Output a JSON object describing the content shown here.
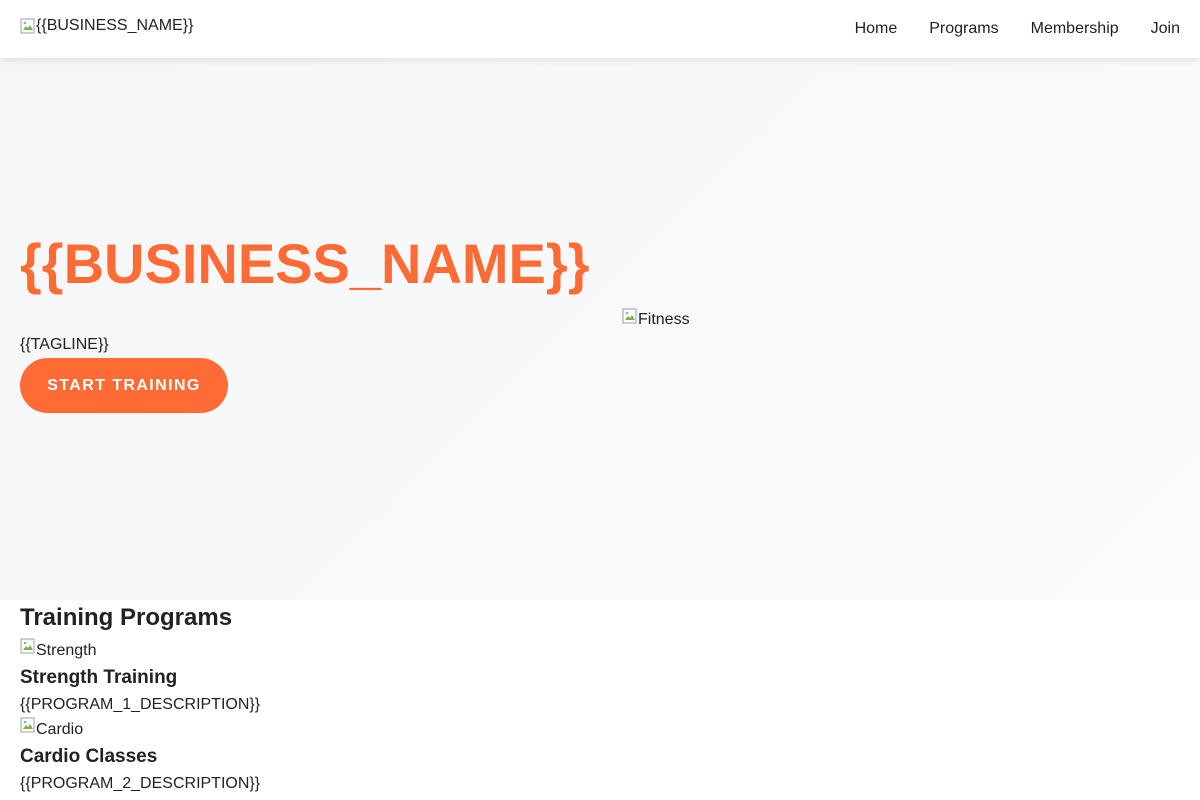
{
  "header": {
    "logo_alt": "{{BUSINESS_NAME}}",
    "nav": [
      {
        "label": "Home"
      },
      {
        "label": "Programs"
      },
      {
        "label": "Membership"
      },
      {
        "label": "Join"
      }
    ]
  },
  "hero": {
    "title": "{{BUSINESS_NAME}}",
    "tagline": "{{TAGLINE}}",
    "cta_label": "START TRAINING",
    "image_alt": "Fitness"
  },
  "programs": {
    "heading": "Training Programs",
    "items": [
      {
        "image_alt": "Strength",
        "title": "Strength Training",
        "description": "{{PROGRAM_1_DESCRIPTION}}"
      },
      {
        "image_alt": "Cardio",
        "title": "Cardio Classes",
        "description": "{{PROGRAM_2_DESCRIPTION}}"
      }
    ]
  },
  "colors": {
    "accent": "#ff6b35",
    "text": "#222222",
    "hero_bg": "#f8f9fa"
  },
  "icons": {
    "broken_image": "broken-image-icon"
  }
}
